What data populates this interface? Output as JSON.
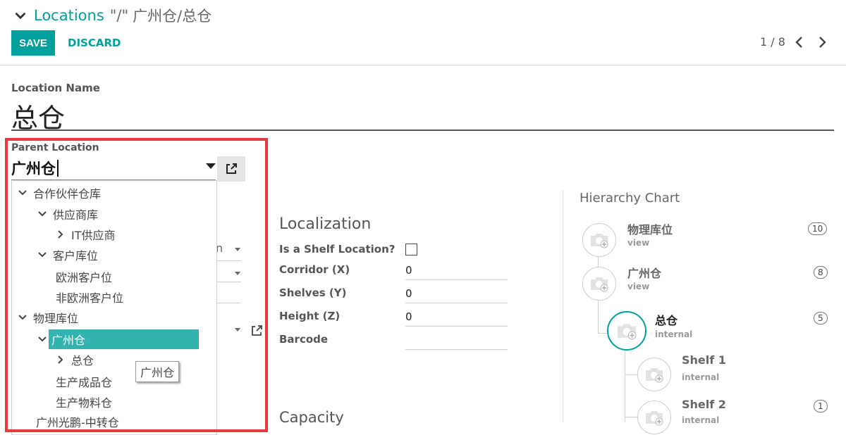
{
  "breadcrumb": {
    "link": "Locations",
    "separator": "\"/\"",
    "current": "广州仓/总仓"
  },
  "toolbar": {
    "save_label": "SAVE",
    "discard_label": "DISCARD"
  },
  "pager": {
    "value": "1 / 8"
  },
  "form": {
    "location_name_label": "Location Name",
    "location_name_value": "总仓",
    "parent_label": "Parent Location",
    "parent_value": "广州仓",
    "ghost_select_fragment": "n"
  },
  "tree": {
    "items": [
      {
        "label": "合作伙伴仓库"
      },
      {
        "label": "供应商库"
      },
      {
        "label": "IT供应商"
      },
      {
        "label": "客户库位"
      },
      {
        "label": "欧洲客户位"
      },
      {
        "label": "非欧洲客户位"
      },
      {
        "label": "物理库位"
      },
      {
        "label": "广州仓"
      },
      {
        "label": "总仓"
      },
      {
        "label": "生产成品仓"
      },
      {
        "label": "生产物料仓"
      },
      {
        "label": "广州光鹏-中转仓"
      }
    ],
    "tooltip": "广州仓"
  },
  "localization": {
    "title": "Localization",
    "shelf_label": "Is a Shelf Location?",
    "corridor_label": "Corridor (X)",
    "corridor_value": "0",
    "shelves_label": "Shelves (Y)",
    "shelves_value": "0",
    "height_label": "Height (Z)",
    "height_value": "0",
    "barcode_label": "Barcode",
    "barcode_value": ""
  },
  "capacity": {
    "title": "Capacity"
  },
  "hierarchy": {
    "title": "Hierarchy Chart",
    "nodes": [
      {
        "name": "物理库位",
        "type": "view",
        "count": "10"
      },
      {
        "name": "广州仓",
        "type": "view",
        "count": "8"
      },
      {
        "name": "总仓",
        "type": "internal",
        "count": "5"
      },
      {
        "name": "Shelf 1",
        "type": "internal",
        "count": ""
      },
      {
        "name": "Shelf 2",
        "type": "internal",
        "count": "1"
      }
    ]
  },
  "colors": {
    "accent": "#00a09d",
    "selected": "#33b3af",
    "highlight": "#e8393f"
  }
}
